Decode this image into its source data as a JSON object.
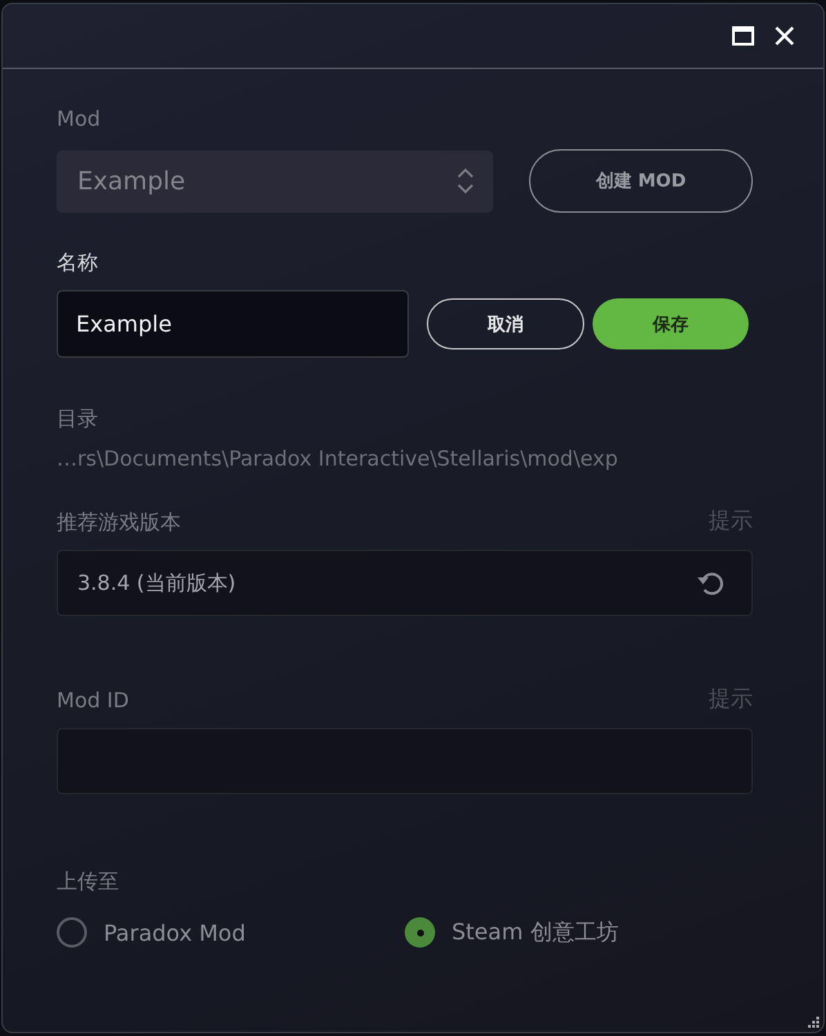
{
  "mod": {
    "label": "Mod",
    "value": "Example",
    "create_button": "创建 MOD"
  },
  "name": {
    "label": "名称",
    "value": "Example",
    "cancel_button": "取消",
    "save_button": "保存"
  },
  "directory": {
    "label": "目录",
    "path": "…rs\\Documents\\Paradox Interactive\\Stellaris\\mod\\exp"
  },
  "game_version": {
    "label": "推荐游戏版本",
    "hint": "提示",
    "value": "3.8.4 (当前版本)"
  },
  "mod_id": {
    "label": "Mod ID",
    "hint": "提示"
  },
  "upload": {
    "label": "上传至",
    "options": [
      {
        "label": "Paradox Mod",
        "selected": false
      },
      {
        "label": "Steam 创意工坊",
        "selected": true
      }
    ]
  }
}
